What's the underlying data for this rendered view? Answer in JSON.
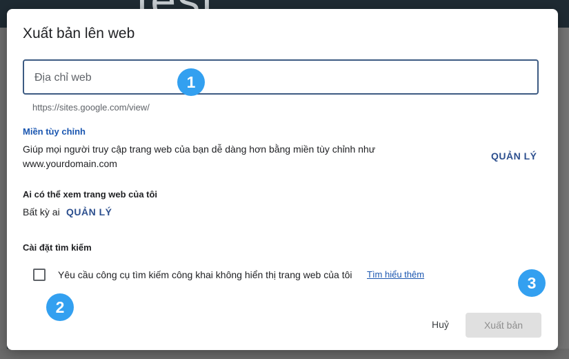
{
  "background": {
    "text": "test"
  },
  "dialog": {
    "title": "Xuất bản lên web",
    "url_field": {
      "placeholder": "Địa chỉ web",
      "value": ""
    },
    "url_hint": "https://sites.google.com/view/",
    "custom_domain": {
      "heading": "Miền tùy chỉnh",
      "description": "Giúp mọi người truy cập trang web của bạn dễ dàng hơn bằng miền tùy chỉnh như www.yourdomain.com",
      "manage_label": "QUẢN LÝ"
    },
    "viewers": {
      "heading": "Ai có thể xem trang web của tôi",
      "value": "Bất kỳ ai",
      "manage_label": "QUẢN LÝ"
    },
    "search": {
      "heading": "Cài đặt tìm kiếm",
      "checkbox_label": "Yêu cầu công cụ tìm kiếm công khai không hiển thị trang web của tôi",
      "checked": false,
      "learn_more": "Tìm hiểu thêm"
    },
    "cancel_label": "Huỷ",
    "publish_label": "Xuất bản"
  },
  "markers": [
    "1",
    "2",
    "3"
  ],
  "colors": {
    "accent": "#1a56b0",
    "marker": "#33a0f0",
    "input_border": "#3c5a82"
  }
}
